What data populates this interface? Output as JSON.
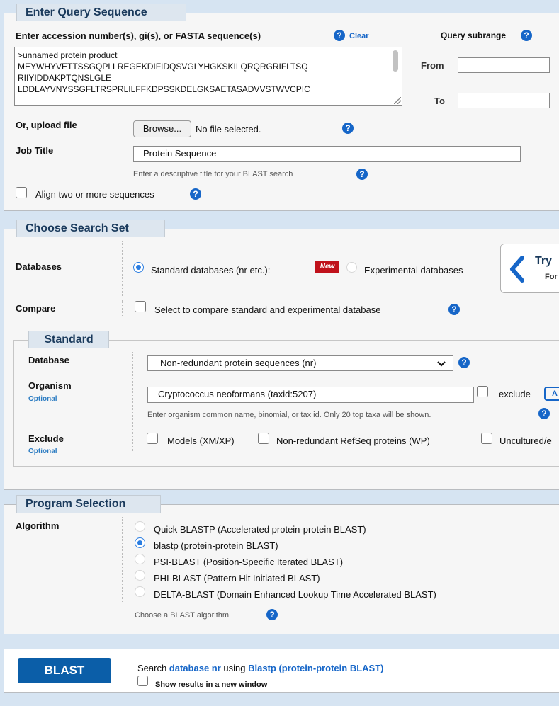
{
  "query": {
    "legend": "Enter Query Sequence",
    "enter_label": "Enter accession number(s), gi(s), or FASTA sequence(s)",
    "clear": "Clear",
    "subrange_label": "Query subrange",
    "from_label": "From",
    "to_label": "To",
    "sequence_lines": [
      ">unnamed protein product",
      "MEYWHYVETTSSGQPLLREGEKDIFIDQSVGLYHGKSKILQRQRGRIFLTSQ",
      "RIIYIDDAKPTQNSLGLE",
      "LDDLAYVNYSSGFLTRSPRLILFFKDPSSKDELGKSAETASADVVSTWVCPIC"
    ],
    "upload_label": "Or, upload file",
    "browse": "Browse...",
    "no_file": "No file selected.",
    "job_title_label": "Job Title",
    "job_title_value": "Protein Sequence",
    "job_title_hint": "Enter a descriptive title for your BLAST search",
    "align_label": "Align two or more sequences"
  },
  "search_set": {
    "legend": "Choose Search Set",
    "databases_label": "Databases",
    "standard_db": "Standard databases (nr etc.):",
    "new_badge": "New",
    "experimental_db": "Experimental databases",
    "try_label": "Try",
    "try_sub": "For",
    "compare_label": "Compare",
    "compare_text": "Select to compare standard and experimental database",
    "standard_legend": "Standard",
    "database_label": "Database",
    "database_value": "Non-redundant protein sequences (nr)",
    "organism_label": "Organism",
    "optional": "Optional",
    "organism_value": "Cryptococcus neoformans (taxid:5207)",
    "exclude_word": "exclude",
    "add_btn": "A",
    "organism_hint": "Enter organism common name, binomial, or tax id. Only 20 top taxa will be shown.",
    "exclude_label": "Exclude",
    "exclude_models": "Models (XM/XP)",
    "exclude_refseq": "Non-redundant RefSeq proteins (WP)",
    "exclude_uncultured": "Uncultured/e"
  },
  "program": {
    "legend": "Program Selection",
    "algorithm_label": "Algorithm",
    "algorithms": [
      "Quick BLASTP (Accelerated protein-protein BLAST)",
      "blastp (protein-protein BLAST)",
      "PSI-BLAST (Position-Specific Iterated BLAST)",
      "PHI-BLAST (Pattern Hit Initiated BLAST)",
      "DELTA-BLAST (Domain Enhanced Lookup Time Accelerated BLAST)"
    ],
    "selected_index": 1,
    "choose_hint": "Choose a BLAST algorithm"
  },
  "submit": {
    "blast_button": "BLAST",
    "search_text_1": "Search ",
    "search_db": "database nr",
    "search_text_2": " using ",
    "search_program": "Blastp (protein-protein BLAST)",
    "new_window": "Show results in a new window"
  },
  "colors": {
    "page_bg": "#d6e4f2",
    "panel_bg": "#f6f6f6",
    "legend_text": "#1a3a5c",
    "link_blue": "#1666c8",
    "blast_button": "#0b5ea8",
    "new_badge": "#c0121b"
  }
}
